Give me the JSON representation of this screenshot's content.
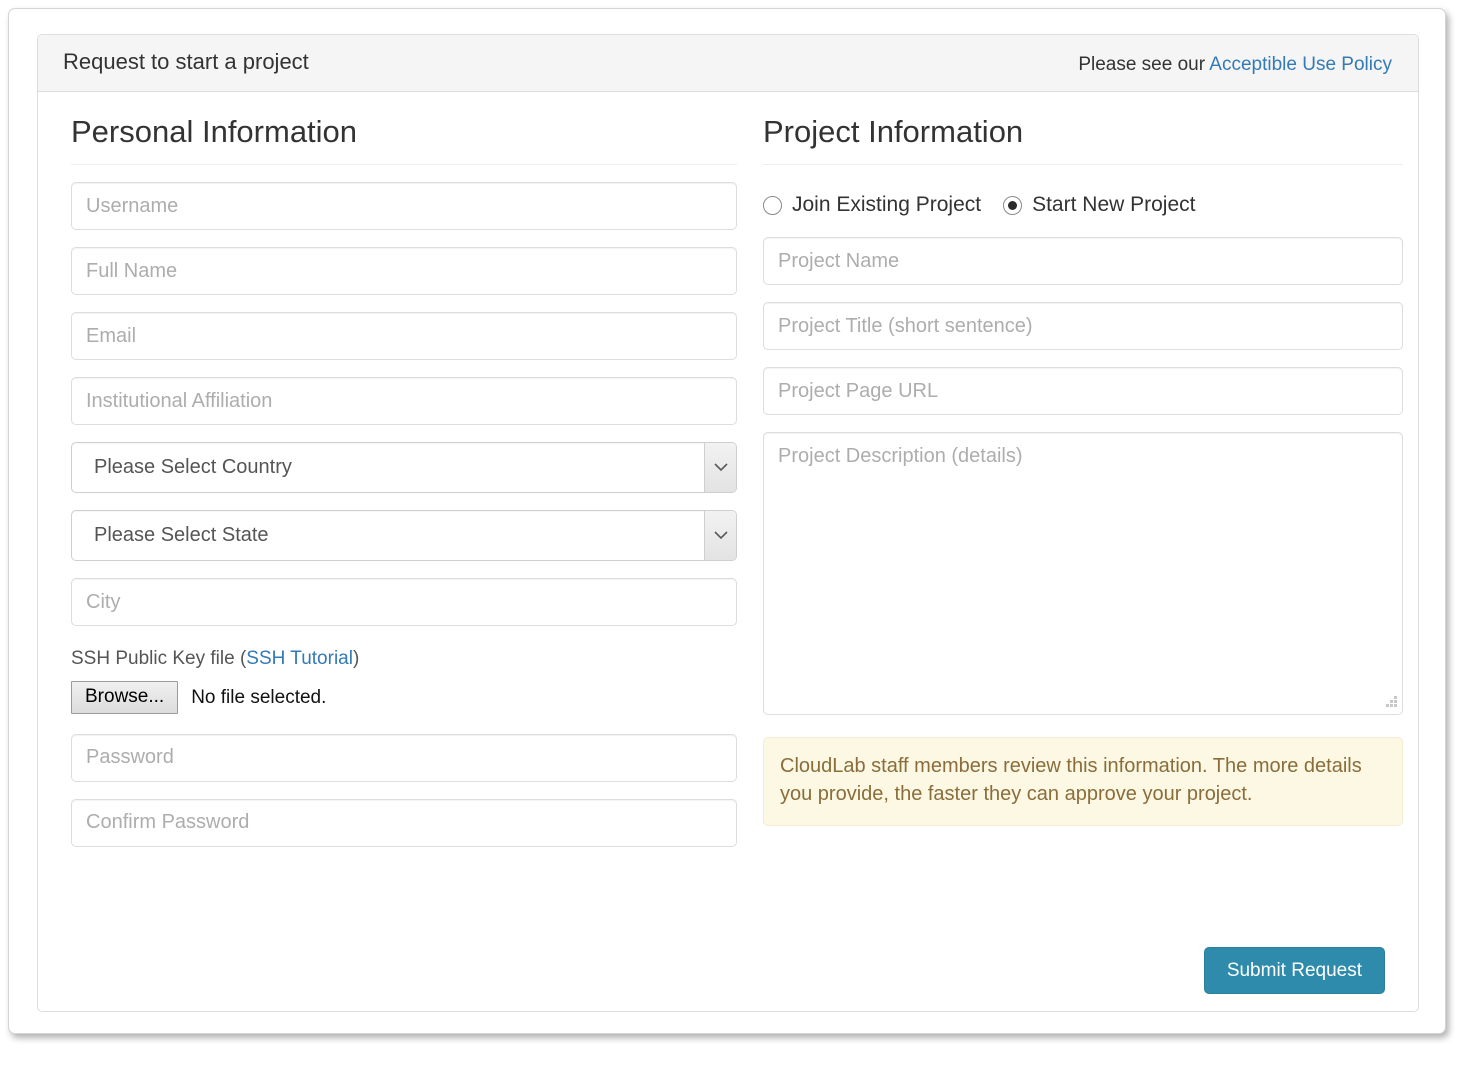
{
  "header": {
    "title": "Request to start a project",
    "note_prefix": "Please see our ",
    "policy_link": "Acceptible Use Policy"
  },
  "personal": {
    "section_title": "Personal Information",
    "username_placeholder": "Username",
    "fullname_placeholder": "Full Name",
    "email_placeholder": "Email",
    "affiliation_placeholder": "Institutional Affiliation",
    "country_selected": "Please Select Country",
    "state_selected": "Please Select State",
    "city_placeholder": "City",
    "ssh_label_prefix": "SSH Public Key file (",
    "ssh_tutorial_link": "SSH Tutorial",
    "ssh_label_suffix": ")",
    "browse_button": "Browse...",
    "file_status": "No file selected.",
    "password_placeholder": "Password",
    "confirm_password_placeholder": "Confirm Password"
  },
  "project": {
    "section_title": "Project Information",
    "radio_join": "Join Existing Project",
    "radio_start": "Start New Project",
    "selected_radio": "Start New Project",
    "name_placeholder": "Project Name",
    "title_placeholder": "Project Title (short sentence)",
    "url_placeholder": "Project Page URL",
    "description_placeholder": "Project Description (details)",
    "alert_text": "CloudLab staff members review this information. The more details you provide, the faster they can approve your project.",
    "submit_button": "Submit Request"
  },
  "colors": {
    "link": "#337ab7",
    "submit_background": "#2e8bab",
    "alert_background": "#fcf8e3",
    "alert_text": "#8a6d3b",
    "panel_heading_background": "#f5f5f5",
    "border": "#dddddd"
  }
}
